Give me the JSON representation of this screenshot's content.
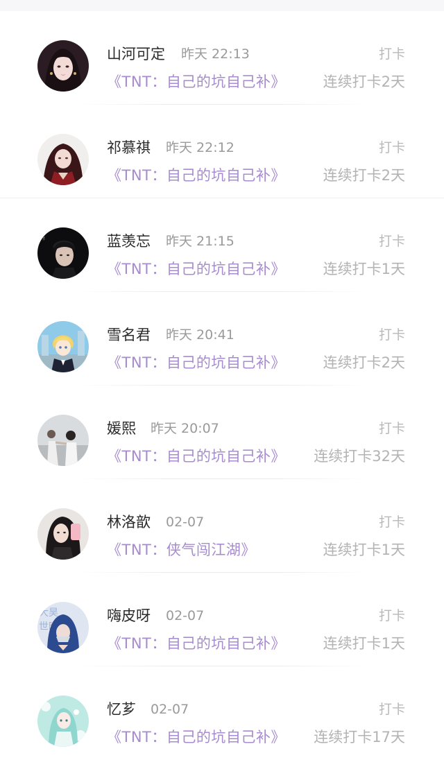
{
  "feed": {
    "items": [
      {
        "name": "山河可定",
        "time": "昨天 22:13",
        "tag": "打卡",
        "book": "《TNT：自己的坑自己补》",
        "streak": "连续打卡2天",
        "avatar_icon": "girl-portrait-avatar"
      },
      {
        "name": "祁慕祺",
        "time": "昨天 22:12",
        "tag": "打卡",
        "book": "《TNT：自己的坑自己补》",
        "streak": "连续打卡2天",
        "avatar_icon": "anime-character-avatar"
      },
      {
        "name": "蓝羡忘",
        "time": "昨天 21:15",
        "tag": "打卡",
        "book": "《TNT：自己的坑自己补》",
        "streak": "连续打卡1天",
        "avatar_icon": "boy-portrait-avatar"
      },
      {
        "name": "雪名君",
        "time": "昨天 20:41",
        "tag": "打卡",
        "book": "《TNT：自己的坑自己补》",
        "streak": "连续打卡2天",
        "avatar_icon": "anime-blonde-avatar"
      },
      {
        "name": "媛熙",
        "time": "昨天 20:07",
        "tag": "打卡",
        "book": "《TNT：自己的坑自己补》",
        "streak": "连续打卡32天",
        "avatar_icon": "photo-avatar"
      },
      {
        "name": "林洛歆",
        "time": "02-07",
        "tag": "打卡",
        "book": "《TNT：侠气闯江湖》",
        "streak": "连续打卡1天",
        "avatar_icon": "girl-selfie-avatar"
      },
      {
        "name": "嗨皮呀",
        "time": "02-07",
        "tag": "打卡",
        "book": "《TNT：自己的坑自己补》",
        "streak": "连续打卡1天",
        "avatar_icon": "hooded-figure-avatar"
      },
      {
        "name": "忆芗",
        "time": "02-07",
        "tag": "打卡",
        "book": "《TNT：自己的坑自己补》",
        "streak": "连续打卡17天",
        "avatar_icon": "anime-flower-avatar"
      }
    ]
  },
  "colors": {
    "name": "#2b2b2b",
    "time": "#9a9a9a",
    "tag": "#b9b9b9",
    "book": "#a78bd0",
    "streak": "#b3b3b3",
    "top_bar": "#f7f6f8"
  }
}
